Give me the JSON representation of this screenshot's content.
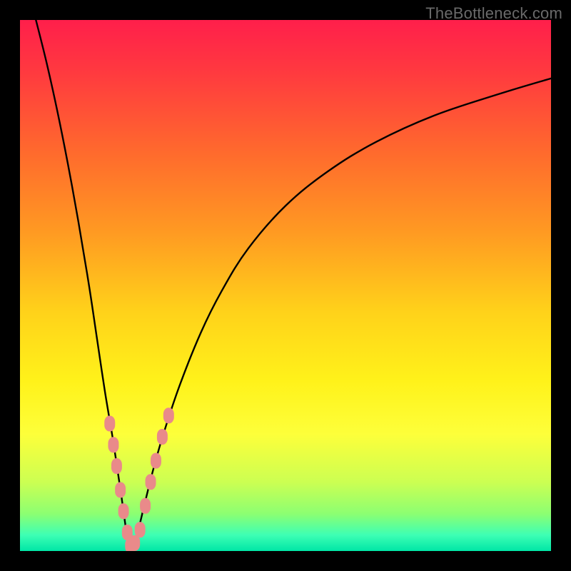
{
  "watermark": {
    "text": "TheBottleneck.com"
  },
  "colors": {
    "frame": "#000000",
    "curve": "#000000",
    "marker_fill": "#e98a8a",
    "marker_stroke": "#e98a8a",
    "gradient_stops": [
      {
        "offset": 0.0,
        "color": "#ff1f4b"
      },
      {
        "offset": 0.1,
        "color": "#ff3a3f"
      },
      {
        "offset": 0.25,
        "color": "#ff6a2d"
      },
      {
        "offset": 0.4,
        "color": "#ff9a22"
      },
      {
        "offset": 0.55,
        "color": "#ffd21a"
      },
      {
        "offset": 0.68,
        "color": "#fff21a"
      },
      {
        "offset": 0.78,
        "color": "#fdff3a"
      },
      {
        "offset": 0.87,
        "color": "#ccff52"
      },
      {
        "offset": 0.93,
        "color": "#8cff72"
      },
      {
        "offset": 0.97,
        "color": "#3dffb4"
      },
      {
        "offset": 1.0,
        "color": "#00e6a6"
      }
    ]
  },
  "chart_data": {
    "type": "line",
    "title": "",
    "xlabel": "",
    "ylabel": "",
    "x_range": [
      0,
      100
    ],
    "y_range": [
      0,
      100
    ],
    "trough_x": 20.8,
    "series": [
      {
        "name": "bottleneck-curve",
        "points": [
          {
            "x": 3.0,
            "y": 100.0
          },
          {
            "x": 5.0,
            "y": 92.0
          },
          {
            "x": 7.0,
            "y": 83.0
          },
          {
            "x": 9.0,
            "y": 73.0
          },
          {
            "x": 11.0,
            "y": 62.0
          },
          {
            "x": 13.0,
            "y": 50.0
          },
          {
            "x": 14.5,
            "y": 40.0
          },
          {
            "x": 16.0,
            "y": 30.0
          },
          {
            "x": 17.5,
            "y": 21.0
          },
          {
            "x": 19.0,
            "y": 11.0
          },
          {
            "x": 20.0,
            "y": 4.0
          },
          {
            "x": 20.8,
            "y": 0.5
          },
          {
            "x": 22.0,
            "y": 3.0
          },
          {
            "x": 23.5,
            "y": 9.0
          },
          {
            "x": 25.0,
            "y": 15.0
          },
          {
            "x": 27.0,
            "y": 22.0
          },
          {
            "x": 30.0,
            "y": 31.0
          },
          {
            "x": 34.0,
            "y": 41.0
          },
          {
            "x": 38.0,
            "y": 49.0
          },
          {
            "x": 43.0,
            "y": 57.0
          },
          {
            "x": 50.0,
            "y": 65.0
          },
          {
            "x": 58.0,
            "y": 71.5
          },
          {
            "x": 67.0,
            "y": 77.0
          },
          {
            "x": 78.0,
            "y": 82.0
          },
          {
            "x": 90.0,
            "y": 86.0
          },
          {
            "x": 100.0,
            "y": 89.0
          }
        ]
      }
    ],
    "markers": [
      {
        "x": 16.9,
        "y": 24.0
      },
      {
        "x": 17.6,
        "y": 20.0
      },
      {
        "x": 18.2,
        "y": 16.0
      },
      {
        "x": 18.9,
        "y": 11.5
      },
      {
        "x": 19.5,
        "y": 7.5
      },
      {
        "x": 20.2,
        "y": 3.5
      },
      {
        "x": 20.8,
        "y": 1.0
      },
      {
        "x": 21.6,
        "y": 1.5
      },
      {
        "x": 22.6,
        "y": 4.0
      },
      {
        "x": 23.6,
        "y": 8.5
      },
      {
        "x": 24.6,
        "y": 13.0
      },
      {
        "x": 25.6,
        "y": 17.0
      },
      {
        "x": 26.8,
        "y": 21.5
      },
      {
        "x": 28.0,
        "y": 25.5
      }
    ]
  }
}
